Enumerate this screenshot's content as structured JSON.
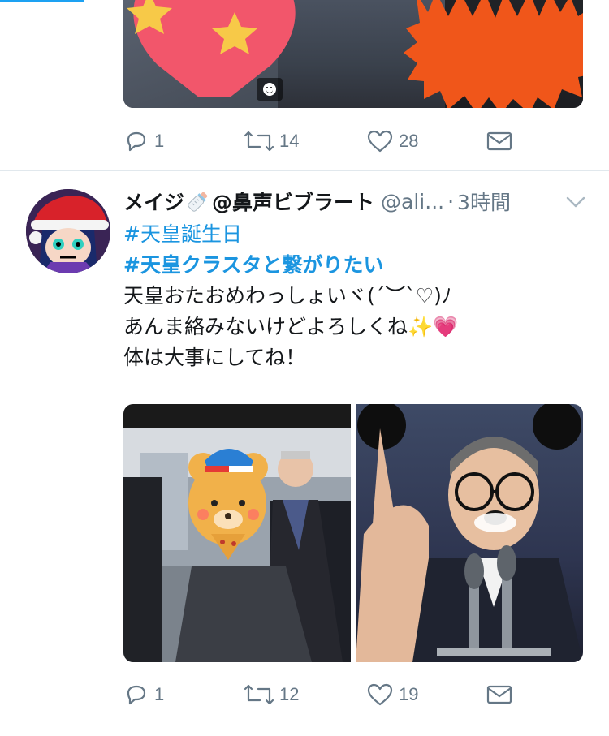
{
  "tweet1": {
    "media_badge_icon": "gif-face-icon",
    "actions": {
      "reply_count": "1",
      "retweet_count": "14",
      "like_count": "28"
    }
  },
  "tweet2": {
    "display_name": "メイジ",
    "display_name_emoji": "baby-bottle-icon",
    "display_name_suffix": "@鼻声ビブラート",
    "handle": "@ali...",
    "separator": "·",
    "time": "3時間",
    "hashtags": [
      "#天皇誕生日",
      "#天皇クラスタと繋がりたい"
    ],
    "lines": [
      "天皇おたおめわっしょいヾ(´︶`♡)ﾉ",
      "あんま絡みないけどよろしくね",
      "体は大事にしてね！"
    ],
    "line2_emojis": [
      "✨",
      "💗"
    ],
    "actions": {
      "reply_count": "1",
      "retweet_count": "12",
      "like_count": "19"
    }
  },
  "colors": {
    "accent": "#1da1f2",
    "hashtag": "#1b95e0",
    "icon_gray": "#657786",
    "divider": "#e1e8ed"
  }
}
